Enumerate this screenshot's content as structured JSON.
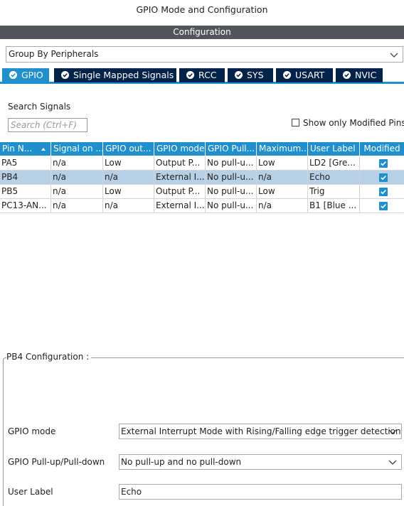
{
  "window_title": "GPIO Mode and Configuration",
  "config_bar": "Configuration",
  "group_select": {
    "value": "Group By Peripherals",
    "icon": "chevron-down-icon"
  },
  "tabs": [
    {
      "label": "GPIO",
      "active": true
    },
    {
      "label": "Single Mapped Signals",
      "active": false
    },
    {
      "label": "RCC",
      "active": false
    },
    {
      "label": "SYS",
      "active": false
    },
    {
      "label": "USART",
      "active": false
    },
    {
      "label": "NVIC",
      "active": false
    }
  ],
  "search": {
    "label": "Search Signals",
    "placeholder": "Search (Ctrl+F)"
  },
  "show_modified": {
    "label": "Show only Modified Pins",
    "checked": false
  },
  "table": {
    "columns": [
      "Pin N...",
      "Signal on ...",
      "GPIO out...",
      "GPIO mode",
      "GPIO Pull...",
      "Maximum...",
      "User Label",
      "Modified"
    ],
    "sort_icon": "sort-icon",
    "rows": [
      {
        "cells": [
          "PA5",
          "n/a",
          "Low",
          "Output P...",
          "No pull-u...",
          "Low",
          "LD2 [Gre..."
        ],
        "modified": true,
        "selected": false
      },
      {
        "cells": [
          "PB4",
          "n/a",
          "n/a",
          "External I...",
          "No pull-u...",
          "n/a",
          "Echo"
        ],
        "modified": true,
        "selected": true
      },
      {
        "cells": [
          "PB5",
          "n/a",
          "Low",
          "Output P...",
          "No pull-u...",
          "Low",
          "Trig"
        ],
        "modified": true,
        "selected": false
      },
      {
        "cells": [
          "PC13-AN...",
          "n/a",
          "n/a",
          "External I...",
          "No pull-u...",
          "n/a",
          "B1 [Blue ..."
        ],
        "modified": true,
        "selected": false
      }
    ]
  },
  "pin_config": {
    "legend": "PB4 Configuration :",
    "gpio_mode": {
      "label": "GPIO mode",
      "value": "External Interrupt Mode with Rising/Falling edge trigger detection"
    },
    "pull": {
      "label": "GPIO Pull-up/Pull-down",
      "value": "No pull-up and no pull-down"
    },
    "user_label": {
      "label": "User Label",
      "value": "Echo"
    }
  },
  "colors": {
    "accent": "#1f8fce",
    "tab_dark": "#03234b",
    "config_bar": "#52565c",
    "row_selected": "#b8d0e6"
  }
}
